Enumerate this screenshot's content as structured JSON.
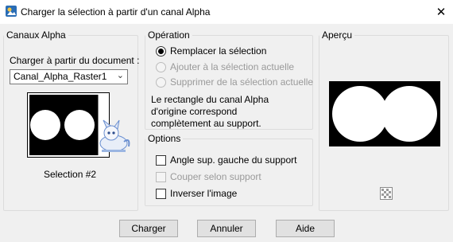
{
  "window": {
    "title": "Charger la sélection à partir d'un canal Alpha"
  },
  "channels": {
    "legend": "Canaux Alpha",
    "load_label": "Charger à partir du document :",
    "document_value": "Canal_Alpha_Raster1",
    "selection_label": "Selection #2"
  },
  "operation": {
    "legend": "Opération",
    "options": [
      {
        "label": "Remplacer la sélection",
        "checked": true,
        "enabled": true
      },
      {
        "label": "Ajouter à la sélection actuelle",
        "checked": false,
        "enabled": false
      },
      {
        "label": "Supprimer de la sélection actuelle",
        "checked": false,
        "enabled": false
      }
    ],
    "note_lines": [
      "Le rectangle du canal Alpha",
      "d'origine correspond",
      "complètement au support."
    ]
  },
  "options": {
    "legend": "Options",
    "items": [
      {
        "label": "Angle sup. gauche du support",
        "checked": false,
        "enabled": true
      },
      {
        "label": "Couper selon support",
        "checked": false,
        "enabled": false
      },
      {
        "label": "Inverser l'image",
        "checked": false,
        "enabled": true
      }
    ]
  },
  "preview": {
    "legend": "Aperçu"
  },
  "buttons": {
    "load": "Charger",
    "cancel": "Annuler",
    "help": "Aide"
  },
  "icons": [
    "app-icon",
    "close-icon",
    "chevron-down-icon",
    "watermark-icon",
    "preview-toggle-icon"
  ]
}
